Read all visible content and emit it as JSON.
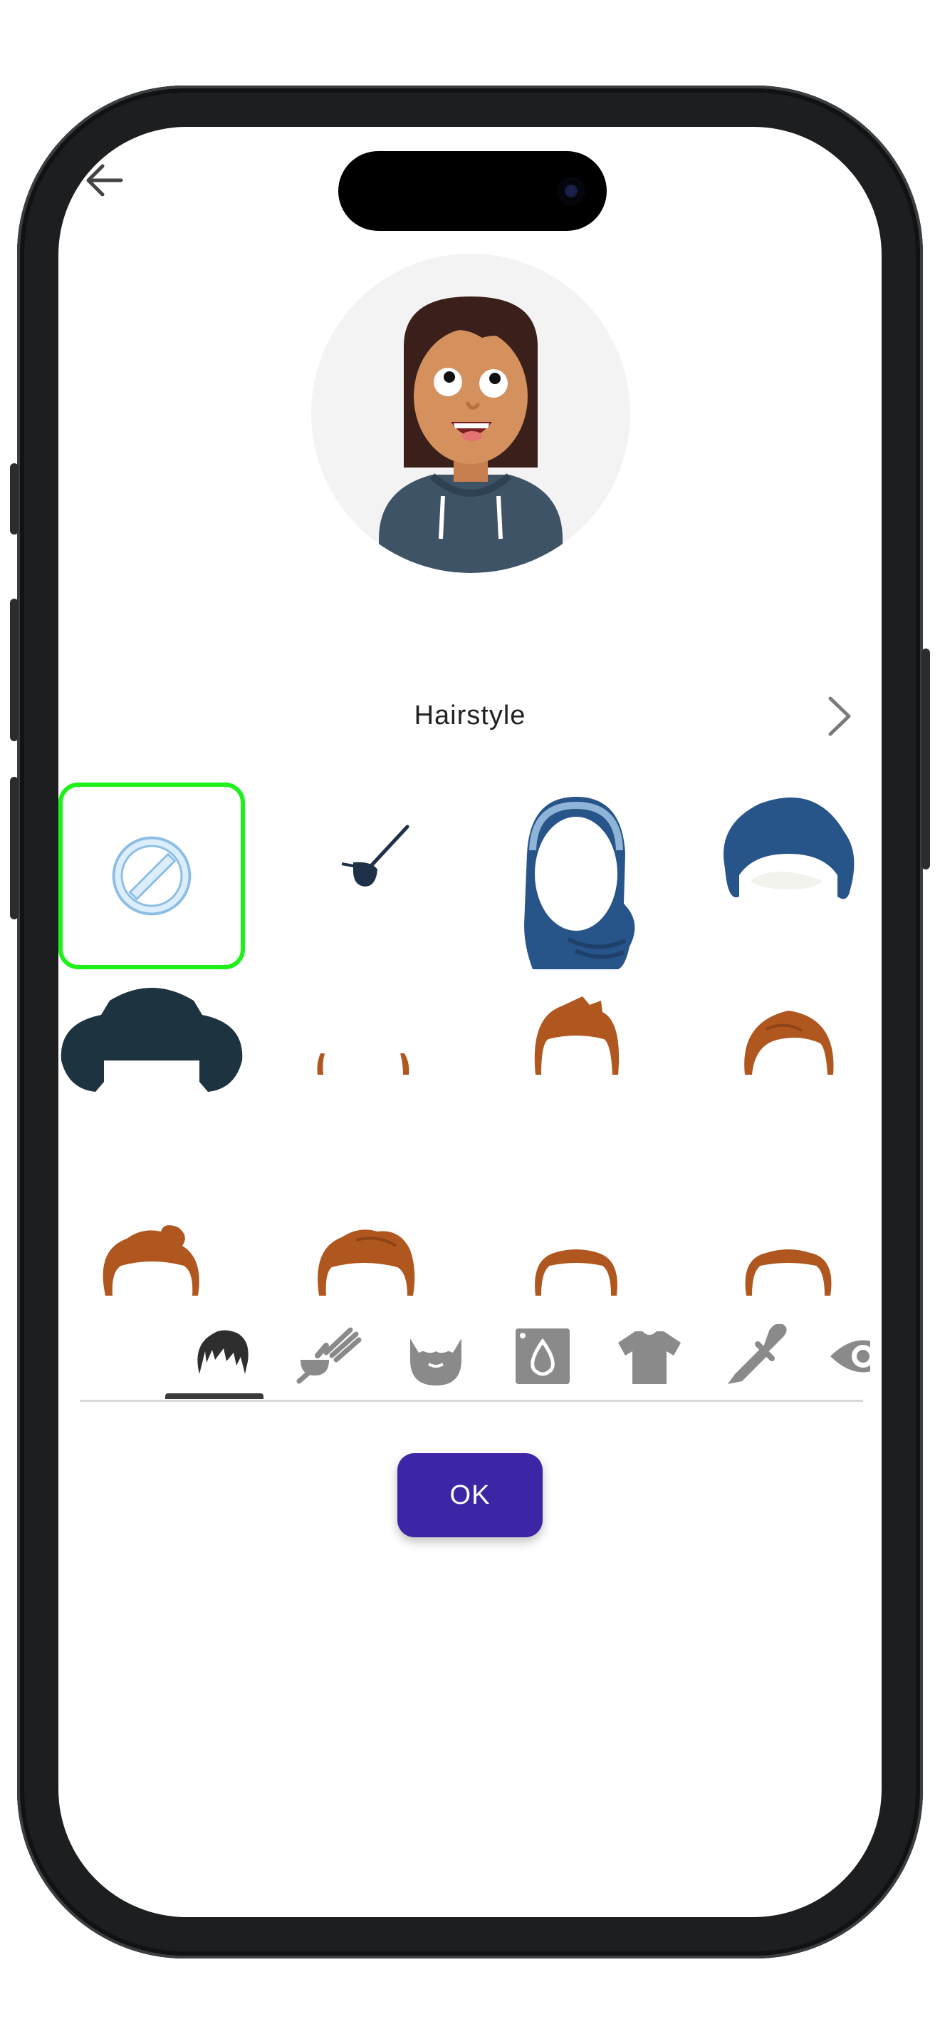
{
  "header": {
    "back_icon": "arrow-left-icon"
  },
  "category": {
    "title": "Hairstyle",
    "next_icon": "chevron-right-icon"
  },
  "options": [
    {
      "name": "none",
      "icon": "no-symbol-icon",
      "selected": true
    },
    {
      "name": "eyepatch"
    },
    {
      "name": "hijab"
    },
    {
      "name": "turban"
    },
    {
      "name": "hat"
    },
    {
      "name": "hair-long-thin"
    },
    {
      "name": "hair-spiky"
    },
    {
      "name": "hair-side-part"
    },
    {
      "name": "hair-bun"
    },
    {
      "name": "hair-quiff"
    },
    {
      "name": "hair-buzz"
    },
    {
      "name": "hair-short"
    }
  ],
  "tabs": [
    {
      "icon": "hairstyle-icon",
      "active": true
    },
    {
      "icon": "barber-tools-icon"
    },
    {
      "icon": "beard-icon"
    },
    {
      "icon": "skin-tone-icon"
    },
    {
      "icon": "shirt-icon"
    },
    {
      "icon": "color-dropper-icon"
    },
    {
      "icon": "eye-icon"
    }
  ],
  "footer": {
    "ok_label": "OK"
  },
  "colors": {
    "accent": "#3d25a5",
    "selection": "#1ef01a",
    "hair": "#b0571f",
    "headwear": "#285589"
  }
}
